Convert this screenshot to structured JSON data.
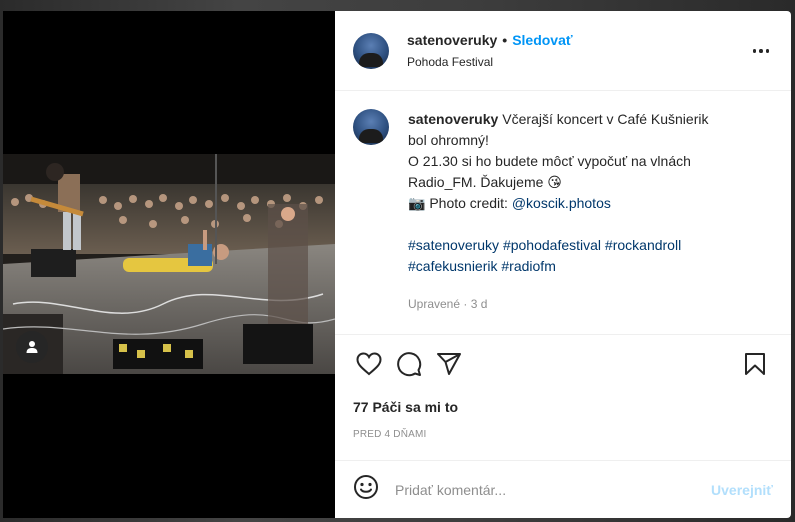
{
  "post": {
    "username": "satenoveruky",
    "separator": "•",
    "follow_label": "Sledovať",
    "location": "Pohoda Festival"
  },
  "caption": {
    "username": "satenoveruky",
    "line1": "Včerajší koncert v Café Kušnierik bol ohromný!",
    "line2": "O 21.30 si ho budete môcť vypočuť na vlnách Radio_FM. Ďakujeme 😘",
    "credit_emoji": "📷",
    "credit_text": "Photo credit:",
    "credit_handle": "@koscik.photos",
    "hashtags": [
      "#satenoveruky",
      "#pohodafestival",
      "#rockandroll",
      "#cafekusnierik",
      "#radiofm"
    ],
    "edited_meta": "Upravené · 3 d"
  },
  "actions": {
    "like_icon": "heart-icon",
    "comment_icon": "comment-icon",
    "share_icon": "share-icon",
    "save_icon": "bookmark-icon"
  },
  "likes_text": "77 Páči sa mi to",
  "post_date": "PRED 4 DŇAMI",
  "comment_box": {
    "placeholder": "Pridať komentár...",
    "post_label": "Uverejniť"
  },
  "colors": {
    "accent": "#0095f6",
    "link": "#00376b",
    "post_disabled": "#b2dffc",
    "muted": "#8e8e8e"
  }
}
